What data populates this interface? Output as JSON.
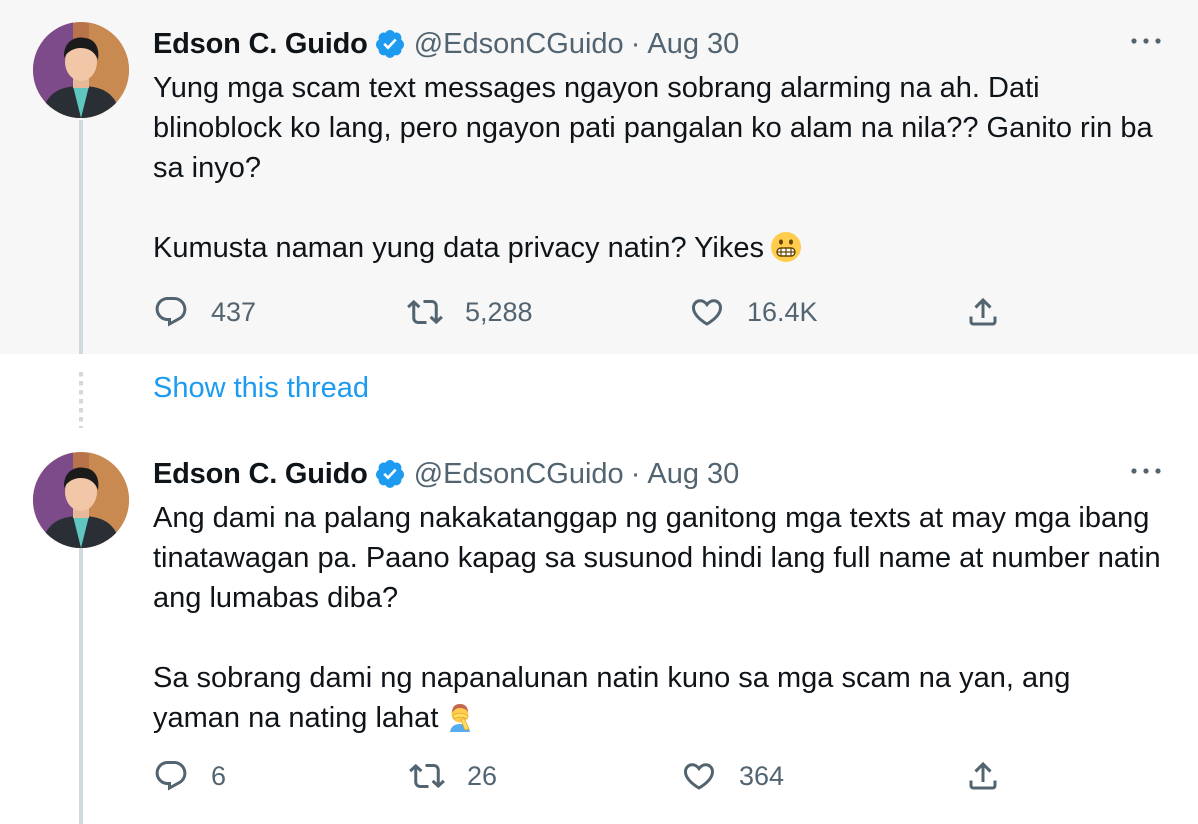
{
  "colors": {
    "accent": "#1d9bf0",
    "secondary_text": "#536471",
    "thread_line": "#cfd9de",
    "highlight_bg": "#f7f7f7"
  },
  "tweets": [
    {
      "display_name": "Edson C. Guido",
      "handle": "@EdsonCGuido",
      "separator": "·",
      "date": "Aug 30",
      "verified": true,
      "paragraphs": [
        "Yung mga scam text messages ngayon sobrang alarming na ah. Dati blinoblock ko lang, pero ngayon pati pangalan ko alam na nila?? Ganito rin ba sa inyo?",
        "Kumusta naman yung data privacy natin? Yikes"
      ],
      "emoji": "grimacing-face",
      "replies": "437",
      "retweets": "5,288",
      "likes": "16.4K"
    },
    {
      "display_name": "Edson C. Guido",
      "handle": "@EdsonCGuido",
      "separator": "·",
      "date": "Aug 30",
      "verified": true,
      "paragraphs": [
        "Ang dami na palang nakakatanggap ng ganitong mga texts at may mga ibang tinatawagan pa. Paano kapag sa susunod hindi lang full name at number natin ang lumabas diba?",
        "Sa sobrang dami ng napanalunan natin kuno sa mga scam na yan, ang yaman na nating lahat"
      ],
      "emoji": "facepalm",
      "replies": "6",
      "retweets": "26",
      "likes": "364"
    }
  ],
  "show_thread_label": "Show this thread",
  "icons": {
    "reply": "reply-icon",
    "retweet": "retweet-icon",
    "like": "heart-icon",
    "share": "share-icon",
    "more": "more-icon",
    "verified": "verified-badge-icon"
  }
}
